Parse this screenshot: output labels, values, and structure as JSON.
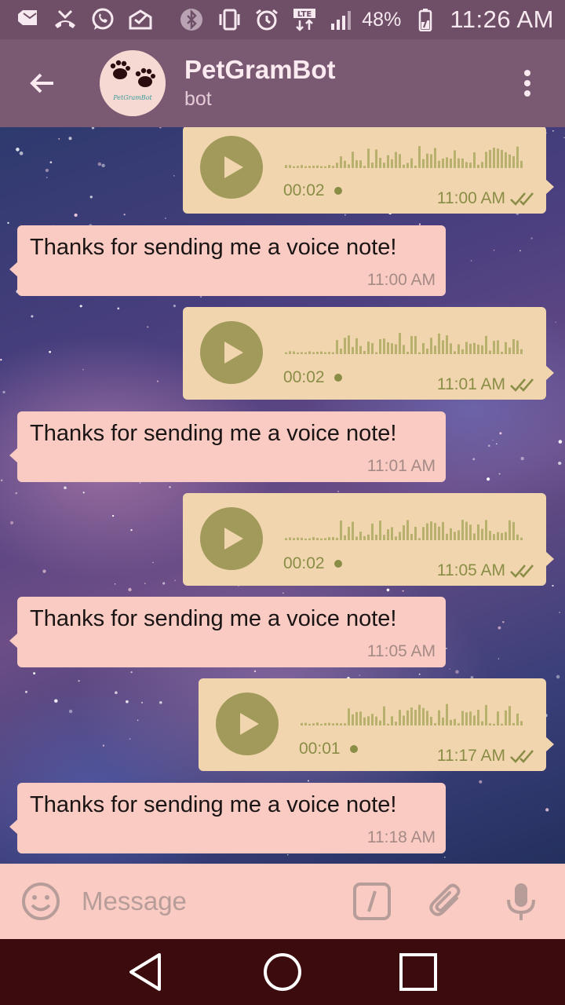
{
  "status_bar": {
    "battery_percent": "48%",
    "time": "11:26 AM",
    "icons": [
      "mail-icon",
      "missed-call-icon",
      "whatsapp-icon",
      "inbox-icon",
      "bluetooth-icon",
      "vibrate-icon",
      "alarm-icon",
      "lte-icon",
      "signal-icon",
      "battery-charging-icon"
    ]
  },
  "header": {
    "title": "PetGramBot",
    "subtitle": "bot",
    "avatar_text": "PetGramBot",
    "back_icon": "arrow-left-icon",
    "menu_icon": "more-vertical-icon"
  },
  "messages": [
    {
      "type": "voice",
      "direction": "out",
      "duration": "00:02",
      "time": "11:00 AM",
      "status": "read"
    },
    {
      "type": "text",
      "direction": "in",
      "text": "Thanks for sending me a voice note!",
      "time": "11:00 AM"
    },
    {
      "type": "voice",
      "direction": "out",
      "duration": "00:02",
      "time": "11:01 AM",
      "status": "read"
    },
    {
      "type": "text",
      "direction": "in",
      "text": "Thanks for sending me a voice note!",
      "time": "11:01 AM"
    },
    {
      "type": "voice",
      "direction": "out",
      "duration": "00:02",
      "time": "11:05 AM",
      "status": "read"
    },
    {
      "type": "text",
      "direction": "in",
      "text": "Thanks for sending me a voice note!",
      "time": "11:05 AM"
    },
    {
      "type": "voice",
      "direction": "out",
      "duration": "00:01",
      "time": "11:17 AM",
      "status": "read"
    },
    {
      "type": "text",
      "direction": "in",
      "text": "Thanks for sending me a voice note!",
      "time": "11:18 AM"
    }
  ],
  "input": {
    "placeholder": "Message",
    "value": "",
    "icons": [
      "emoji-icon",
      "bot-command-icon",
      "attach-icon",
      "microphone-icon"
    ]
  },
  "colors": {
    "status_bar": "#6f4f67",
    "app_bar": "#7a5a73",
    "incoming_bubble": "#f9cbc3",
    "outgoing_bubble": "#f0d5ae",
    "accent_olive": "#a19a5a",
    "nav_bar": "#3b0b0e"
  }
}
